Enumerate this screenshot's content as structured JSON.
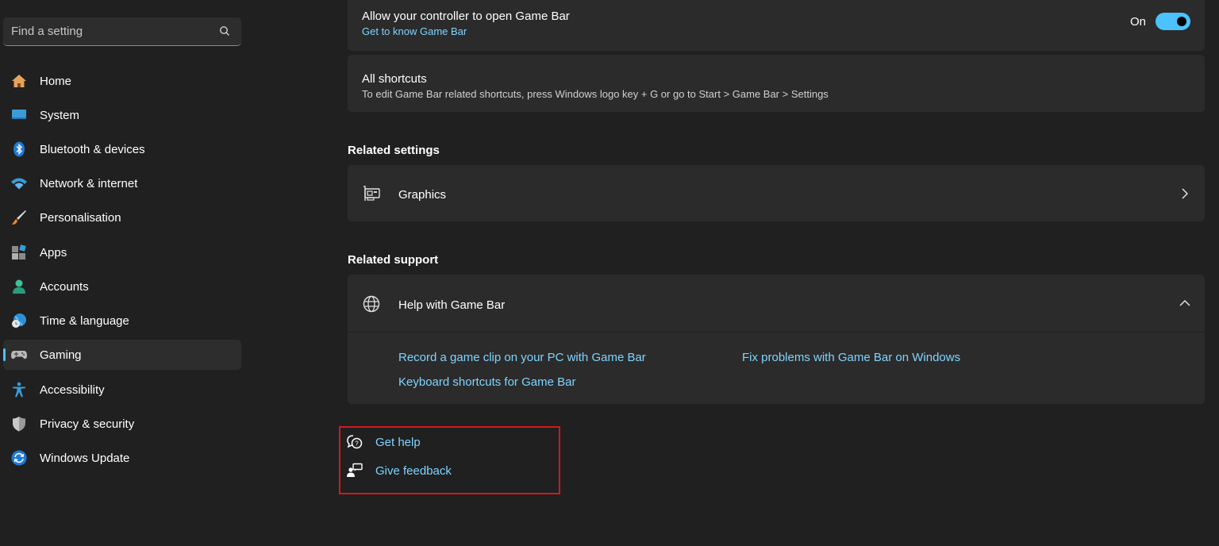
{
  "search": {
    "placeholder": "Find a setting",
    "icon": "search-icon"
  },
  "sidebar": {
    "items": [
      {
        "label": "Home",
        "icon": "home-icon"
      },
      {
        "label": "System",
        "icon": "monitor-icon"
      },
      {
        "label": "Bluetooth & devices",
        "icon": "bluetooth-icon"
      },
      {
        "label": "Network & internet",
        "icon": "wifi-icon"
      },
      {
        "label": "Personalisation",
        "icon": "brush-icon"
      },
      {
        "label": "Apps",
        "icon": "apps-icon"
      },
      {
        "label": "Accounts",
        "icon": "person-icon"
      },
      {
        "label": "Time & language",
        "icon": "globe-clock-icon"
      },
      {
        "label": "Gaming",
        "icon": "gamepad-icon",
        "active": true
      },
      {
        "label": "Accessibility",
        "icon": "accessibility-icon"
      },
      {
        "label": "Privacy & security",
        "icon": "shield-icon"
      },
      {
        "label": "Windows Update",
        "icon": "update-icon"
      }
    ]
  },
  "main": {
    "controller": {
      "title": "Allow your controller to open Game Bar",
      "link": "Get to know Game Bar",
      "toggle_label": "On",
      "toggle_on": true
    },
    "shortcuts": {
      "title": "All shortcuts",
      "description": "To edit Game Bar related shortcuts, press Windows logo key + G or go to Start > Game Bar > Settings"
    },
    "related_settings": {
      "heading": "Related settings",
      "graphics_label": "Graphics"
    },
    "related_support": {
      "heading": "Related support",
      "help_title": "Help with Game Bar",
      "links": [
        "Record a game clip on your PC with Game Bar",
        "Fix problems with Game Bar on Windows",
        "Keyboard shortcuts for Game Bar"
      ]
    },
    "footer": {
      "get_help": "Get help",
      "give_feedback": "Give feedback"
    }
  },
  "colors": {
    "accent": "#4cc2ff",
    "link": "#7fd4ff",
    "highlight_box": "#d3181d",
    "background": "#202020",
    "card": "#2b2b2b"
  }
}
